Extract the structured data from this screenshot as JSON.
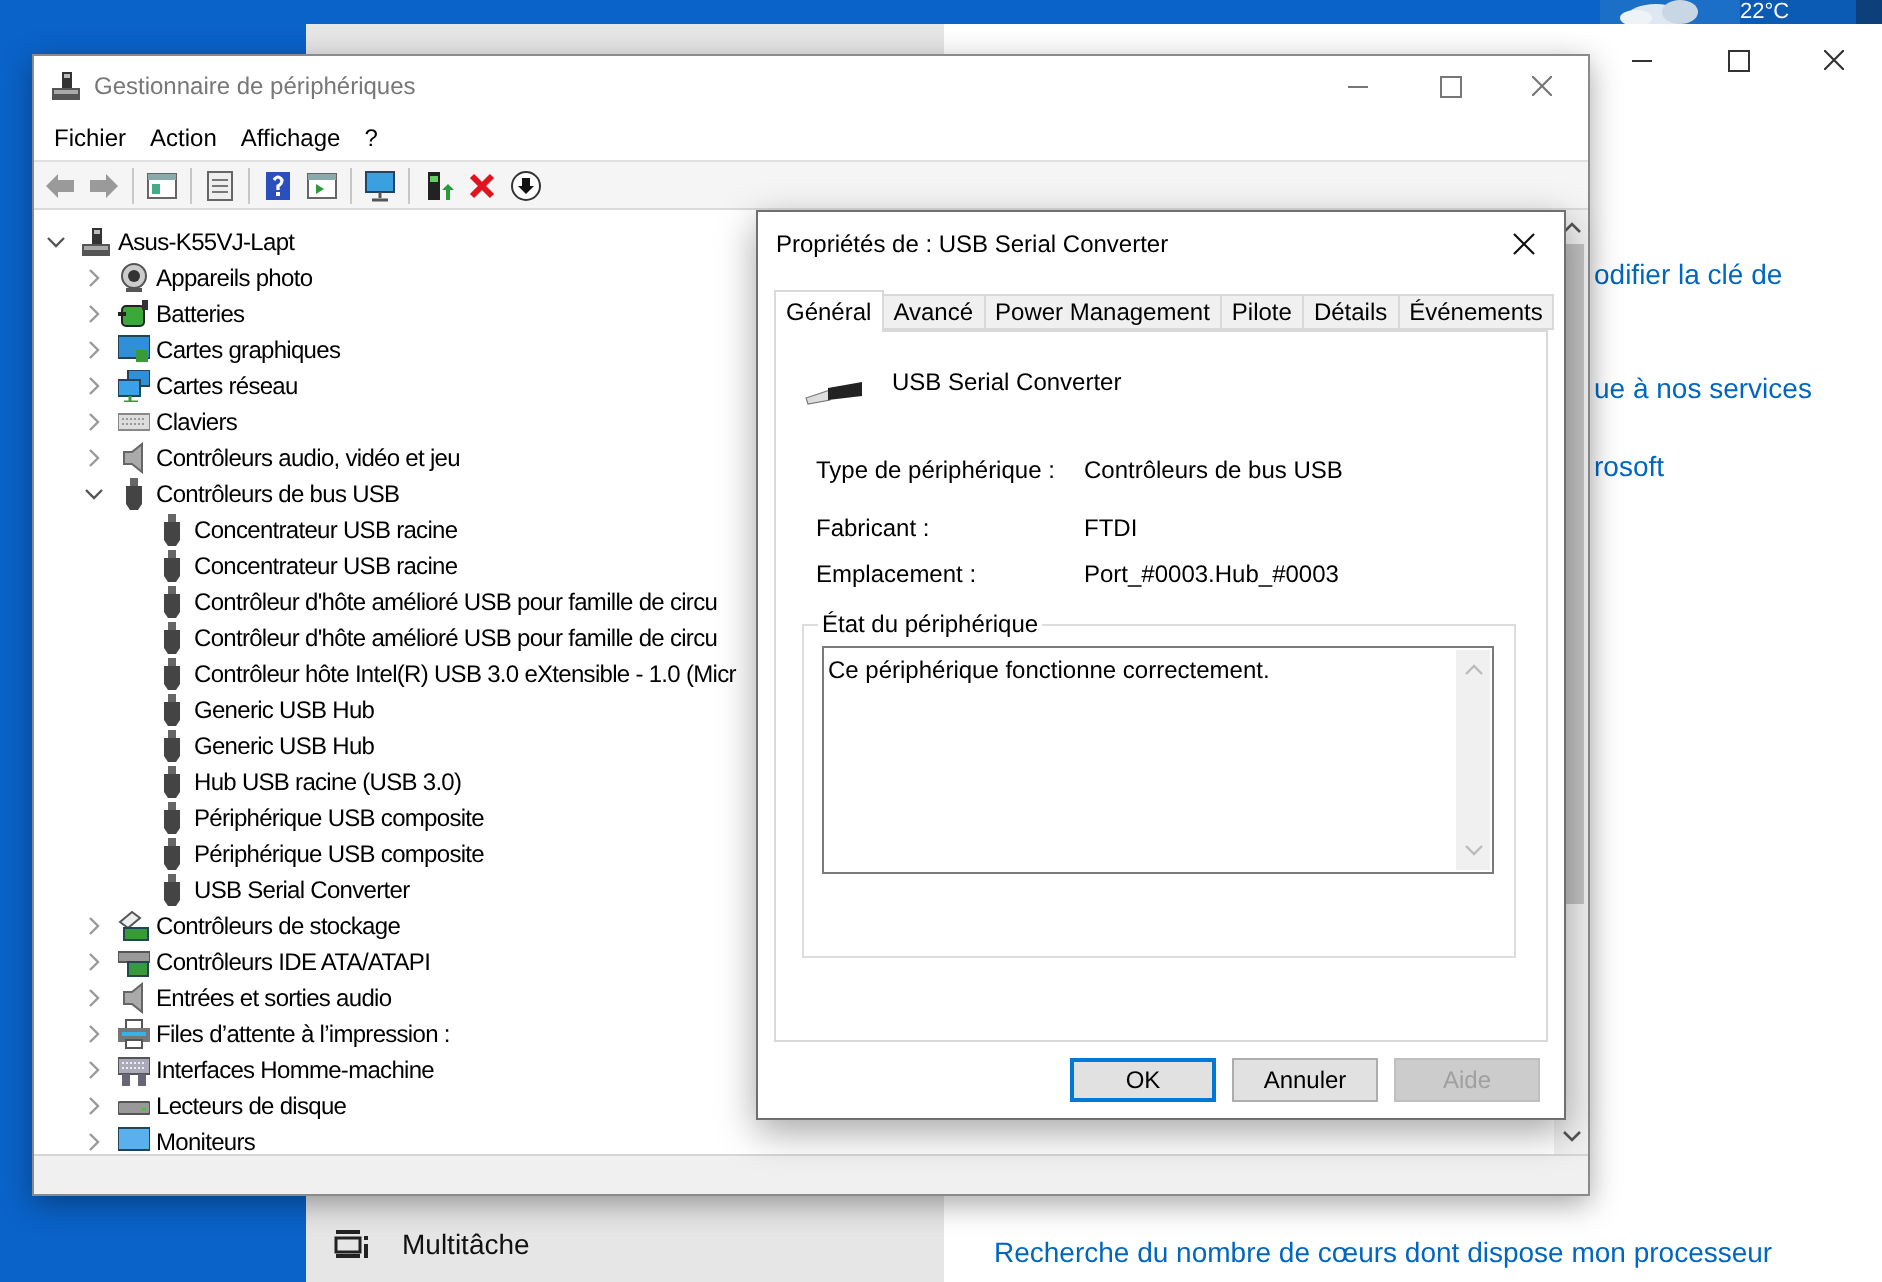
{
  "desktop": {
    "weather": {
      "temperature": "22°C"
    }
  },
  "settings_window": {
    "sidebar_items": [
      {
        "label": "Multitâche"
      }
    ],
    "links": [
      {
        "text": "odifier la clé de"
      },
      {
        "text": "ue à nos services"
      },
      {
        "text": "rosoft"
      },
      {
        "text": "Recherche du nombre de cœurs dont dispose mon processeur"
      }
    ]
  },
  "device_manager": {
    "title": "Gestionnaire de périphériques",
    "menu": [
      "Fichier",
      "Action",
      "Affichage",
      "?"
    ],
    "tree": {
      "label": "Asus-K55VJ-Lapt",
      "expanded": true,
      "children": [
        {
          "label": "Appareils photo",
          "expanded": false
        },
        {
          "label": "Batteries",
          "expanded": false
        },
        {
          "label": "Cartes graphiques",
          "expanded": false
        },
        {
          "label": "Cartes réseau",
          "expanded": false
        },
        {
          "label": "Claviers",
          "expanded": false
        },
        {
          "label": "Contrôleurs audio, vidéo et jeu",
          "expanded": false
        },
        {
          "label": "Contrôleurs de bus USB",
          "expanded": true,
          "children": [
            {
              "label": "Concentrateur USB racine"
            },
            {
              "label": "Concentrateur USB racine"
            },
            {
              "label": "Contrôleur d'hôte amélioré USB pour famille de circu"
            },
            {
              "label": "Contrôleur d'hôte amélioré USB pour famille de circu"
            },
            {
              "label": "Contrôleur hôte Intel(R) USB 3.0 eXtensible - 1.0 (Micr"
            },
            {
              "label": "Generic USB Hub"
            },
            {
              "label": "Generic USB Hub"
            },
            {
              "label": "Hub USB racine (USB 3.0)"
            },
            {
              "label": "Périphérique USB composite"
            },
            {
              "label": "Périphérique USB composite"
            },
            {
              "label": "USB Serial Converter"
            }
          ]
        },
        {
          "label": "Contrôleurs de stockage",
          "expanded": false
        },
        {
          "label": "Contrôleurs IDE ATA/ATAPI",
          "expanded": false
        },
        {
          "label": "Entrées et sorties audio",
          "expanded": false
        },
        {
          "label": "Files d’attente à l’impression :",
          "expanded": false
        },
        {
          "label": "Interfaces Homme-machine",
          "expanded": false
        },
        {
          "label": "Lecteurs de disque",
          "expanded": false
        },
        {
          "label": "Moniteurs",
          "expanded": false
        }
      ]
    }
  },
  "properties_dialog": {
    "title": "Propriétés de : USB Serial Converter",
    "tabs": [
      {
        "label": "Général",
        "selected": true
      },
      {
        "label": "Avancé",
        "selected": false
      },
      {
        "label": "Power Management",
        "selected": false
      },
      {
        "label": "Pilote",
        "selected": false
      },
      {
        "label": "Détails",
        "selected": false
      },
      {
        "label": "Événements",
        "selected": false
      }
    ],
    "device_name": "USB Serial Converter",
    "fields": [
      {
        "label": "Type de périphérique :",
        "value": "Contrôleurs de bus USB"
      },
      {
        "label": "Fabricant :",
        "value": "FTDI"
      },
      {
        "label": "Emplacement :",
        "value": "Port_#0003.Hub_#0003"
      }
    ],
    "status_group": {
      "title": "État du périphérique",
      "text": "Ce périphérique fonctionne correctement."
    },
    "buttons": [
      {
        "label": "OK",
        "default": true,
        "disabled": false
      },
      {
        "label": "Annuler",
        "default": false,
        "disabled": false
      },
      {
        "label": "Aide",
        "default": false,
        "disabled": true
      }
    ]
  }
}
